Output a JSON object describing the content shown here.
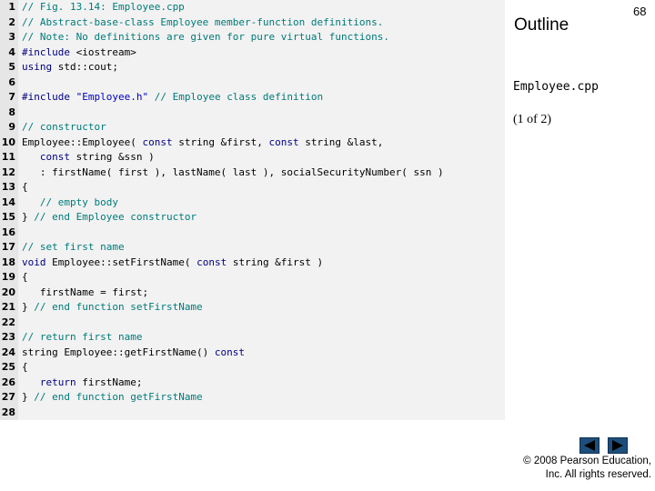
{
  "slide": {
    "outline_label": "Outline",
    "page_number": "68",
    "file_name": "Employee.cpp",
    "part_label": "(1 of 2)",
    "copyright_line1": "© 2008 Pearson Education,",
    "copyright_line2": "Inc.  All rights reserved.",
    "nav_prev_icon": "previous-arrow-icon",
    "nav_next_icon": "next-arrow-icon"
  },
  "code_lines": [
    {
      "n": "1",
      "tokens": [
        [
          "comment",
          "// Fig. 13.14: Employee.cpp"
        ]
      ]
    },
    {
      "n": "2",
      "tokens": [
        [
          "comment",
          "// Abstract-base-class Employee member-function definitions."
        ]
      ]
    },
    {
      "n": "3",
      "tokens": [
        [
          "comment",
          "// Note: No definitions are given for pure virtual functions."
        ]
      ]
    },
    {
      "n": "4",
      "tokens": [
        [
          "keyword",
          "#include"
        ],
        [
          "plain",
          " <iostream>"
        ]
      ]
    },
    {
      "n": "5",
      "tokens": [
        [
          "keyword",
          "using"
        ],
        [
          "plain",
          " std::cout;"
        ]
      ]
    },
    {
      "n": "6",
      "tokens": []
    },
    {
      "n": "7",
      "tokens": [
        [
          "keyword",
          "#include"
        ],
        [
          "plain",
          " "
        ],
        [
          "string",
          "\"Employee.h\""
        ],
        [
          "plain",
          " "
        ],
        [
          "comment",
          "// Employee class definition"
        ]
      ]
    },
    {
      "n": "8",
      "tokens": []
    },
    {
      "n": "9",
      "tokens": [
        [
          "comment",
          "// constructor"
        ]
      ]
    },
    {
      "n": "10",
      "tokens": [
        [
          "plain",
          "Employee::Employee( "
        ],
        [
          "keyword",
          "const"
        ],
        [
          "plain",
          " string &first, "
        ],
        [
          "keyword",
          "const"
        ],
        [
          "plain",
          " string &last,"
        ]
      ]
    },
    {
      "n": "11",
      "tokens": [
        [
          "plain",
          "   "
        ],
        [
          "keyword",
          "const"
        ],
        [
          "plain",
          " string &ssn )"
        ]
      ]
    },
    {
      "n": "12",
      "tokens": [
        [
          "plain",
          "   : firstName( first ), lastName( last ), socialSecurityNumber( ssn )"
        ]
      ]
    },
    {
      "n": "13",
      "tokens": [
        [
          "plain",
          "{"
        ]
      ]
    },
    {
      "n": "14",
      "tokens": [
        [
          "plain",
          "   "
        ],
        [
          "comment",
          "// empty body"
        ]
      ]
    },
    {
      "n": "15",
      "tokens": [
        [
          "plain",
          "} "
        ],
        [
          "comment",
          "// end Employee constructor"
        ]
      ]
    },
    {
      "n": "16",
      "tokens": []
    },
    {
      "n": "17",
      "tokens": [
        [
          "comment",
          "// set first name"
        ]
      ]
    },
    {
      "n": "18",
      "tokens": [
        [
          "keyword",
          "void"
        ],
        [
          "plain",
          " Employee::setFirstName( "
        ],
        [
          "keyword",
          "const"
        ],
        [
          "plain",
          " string &first )"
        ]
      ]
    },
    {
      "n": "19",
      "tokens": [
        [
          "plain",
          "{"
        ]
      ]
    },
    {
      "n": "20",
      "tokens": [
        [
          "plain",
          "   firstName = first;"
        ]
      ]
    },
    {
      "n": "21",
      "tokens": [
        [
          "plain",
          "} "
        ],
        [
          "comment",
          "// end function setFirstName"
        ]
      ]
    },
    {
      "n": "22",
      "tokens": []
    },
    {
      "n": "23",
      "tokens": [
        [
          "comment",
          "// return first name"
        ]
      ]
    },
    {
      "n": "24",
      "tokens": [
        [
          "plain",
          "string Employee::getFirstName() "
        ],
        [
          "keyword",
          "const"
        ]
      ]
    },
    {
      "n": "25",
      "tokens": [
        [
          "plain",
          "{"
        ]
      ]
    },
    {
      "n": "26",
      "tokens": [
        [
          "plain",
          "   "
        ],
        [
          "keyword",
          "return"
        ],
        [
          "plain",
          " firstName;"
        ]
      ]
    },
    {
      "n": "27",
      "tokens": [
        [
          "plain",
          "} "
        ],
        [
          "comment",
          "// end function getFirstName"
        ]
      ]
    },
    {
      "n": "28",
      "tokens": []
    }
  ]
}
